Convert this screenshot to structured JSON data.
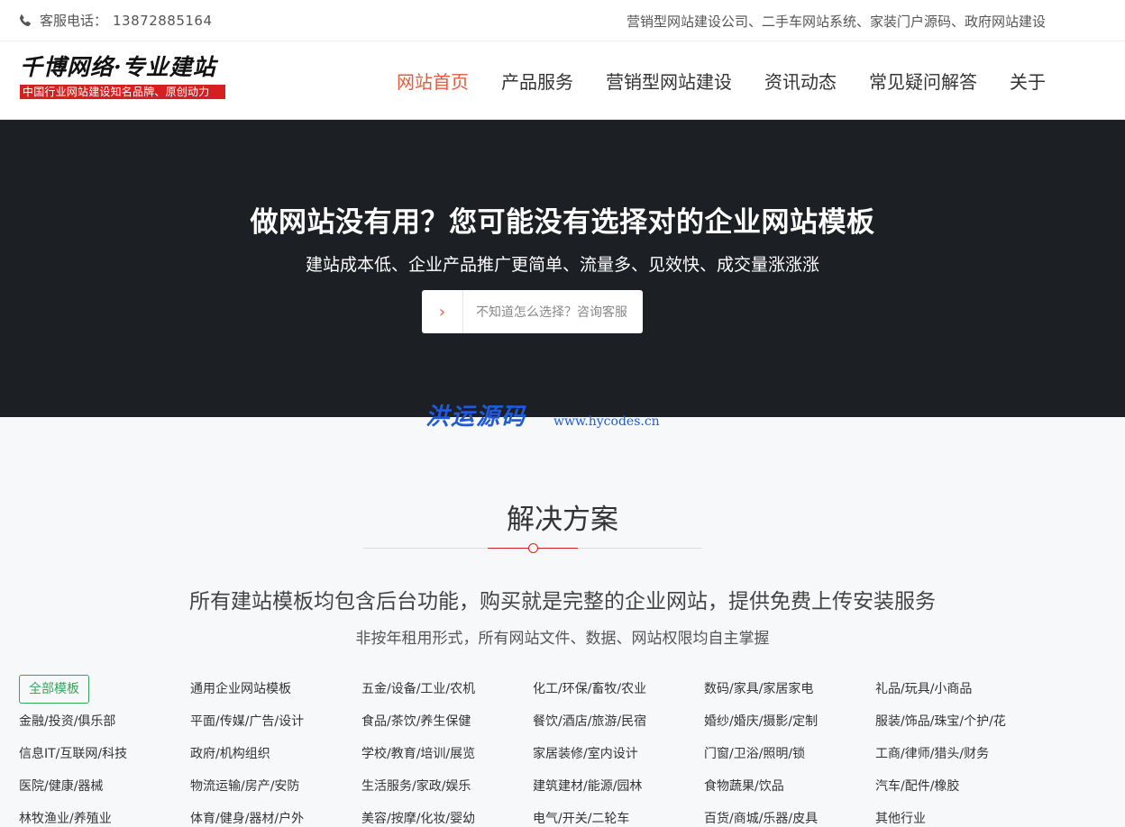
{
  "topbar": {
    "phone_label": "客服电话：",
    "phone_number": "13872885164",
    "tagline": "营销型网站建设公司、二手车网站系统、家装门户源码、政府网站建设"
  },
  "logo": {
    "title": "千博网络·专业建站",
    "subtitle": "中国行业网站建设知名品牌、原创动力"
  },
  "nav": {
    "items": [
      "网站首页",
      "产品服务",
      "营销型网站建设",
      "资讯动态",
      "常见疑问解答",
      "关于"
    ],
    "active_index": 0,
    "active_color": "#e25c3d"
  },
  "hero": {
    "title": "做网站没有用？您可能没有选择对的企业网站模板",
    "subtitle": "建站成本低、企业产品推广更简单、流量多、见效快、成交量涨涨涨",
    "cta_icon": "chevron-right-icon",
    "cta_text": "不知道怎么选择？咨询客服",
    "background": "#1c1f23"
  },
  "watermark": {
    "name": "洪运源码",
    "url": "www.hycodes.cn"
  },
  "section": {
    "title": "解决方案",
    "lead": "所有建站模板均包含后台功能，购买就是完整的企业网站，提供免费上传安装服务",
    "lead2": "非按年租用形式，所有网站文件、数据、网站权限均自主掌握"
  },
  "categories": [
    "全部模板",
    "通用企业网站模板",
    "五金/设备/工业/农机",
    "化工/环保/畜牧/农业",
    "数码/家具/家居家电",
    "礼品/玩具/小商品",
    "金融/投资/俱乐部",
    "平面/传媒/广告/设计",
    "食品/茶饮/养生保健",
    "餐饮/酒店/旅游/民宿",
    "婚纱/婚庆/摄影/定制",
    "服装/饰品/珠宝/个护/花",
    "信息IT/互联网/科技",
    "政府/机构组织",
    "学校/教育/培训/展览",
    "家居装修/室内设计",
    "门窗/卫浴/照明/锁",
    "工商/律师/猎头/财务",
    "医院/健康/器械",
    "物流运输/房产/安防",
    "生活服务/家政/娱乐",
    "建筑建材/能源/园林",
    "食物蔬果/饮品",
    "汽车/配件/橡胶",
    "林牧渔业/养殖业",
    "体育/健身/器材/户外",
    "美容/按摩/化妆/婴幼",
    "电气/开关/二轮车",
    "百货/商城/乐器/皮具",
    "其他行业"
  ],
  "colors": {
    "accent_red": "#d62020",
    "accent_green": "#3aa35a",
    "watermark_blue": "#1f5bd8"
  }
}
